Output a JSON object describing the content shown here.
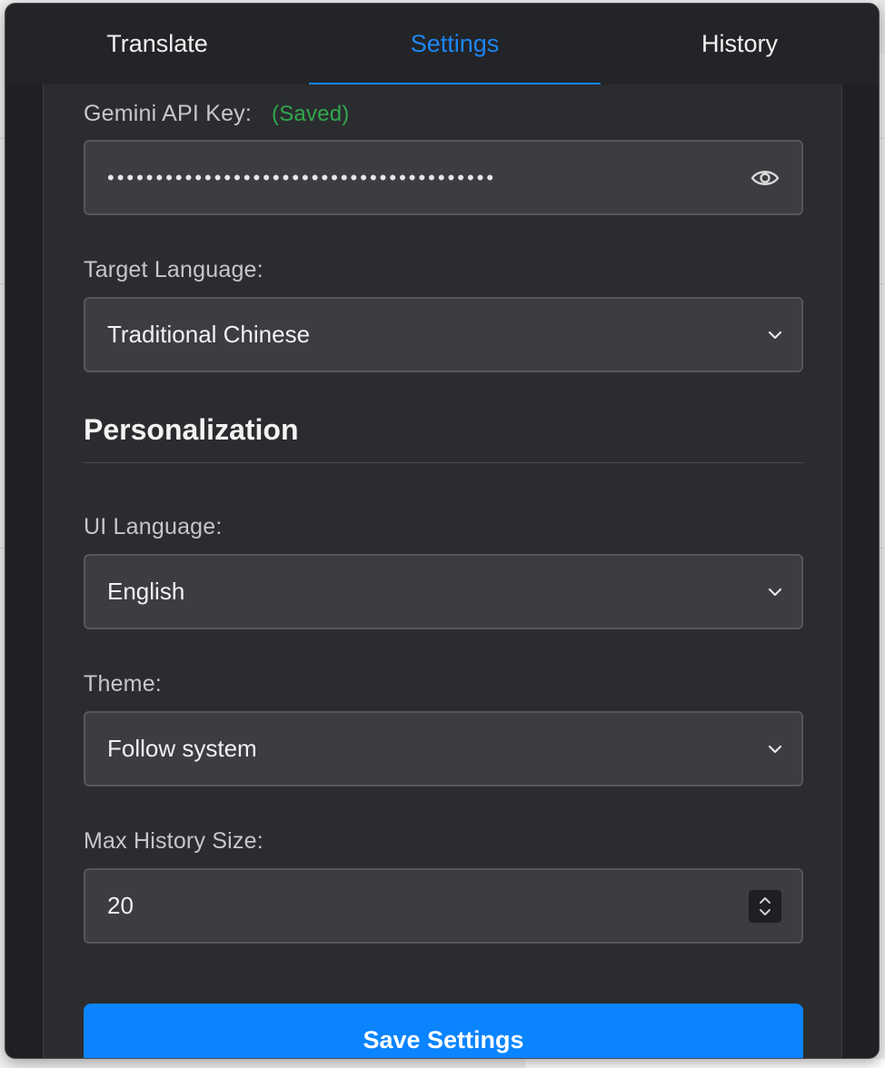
{
  "tabs": [
    {
      "label": "Translate"
    },
    {
      "label": "Settings"
    },
    {
      "label": "History"
    }
  ],
  "settings": {
    "api_key": {
      "label": "Gemini API Key:",
      "status": "(Saved)",
      "masked_value": "••••••••••••••••••••••••••••••••••••••••"
    },
    "target_language": {
      "label": "Target Language:",
      "value": "Traditional Chinese"
    },
    "personalization_heading": "Personalization",
    "ui_language": {
      "label": "UI Language:",
      "value": "English"
    },
    "theme": {
      "label": "Theme:",
      "value": "Follow system"
    },
    "max_history": {
      "label": "Max History Size:",
      "value": "20"
    },
    "save_button": "Save Settings"
  },
  "colors": {
    "accent": "#0a84ff",
    "saved": "#30a84c",
    "background": "#2b2c2f"
  },
  "icons": {
    "password_toggle": "eye-icon",
    "select_arrow": "chevron-down-icon",
    "number_stepper": "stepper-icon"
  }
}
